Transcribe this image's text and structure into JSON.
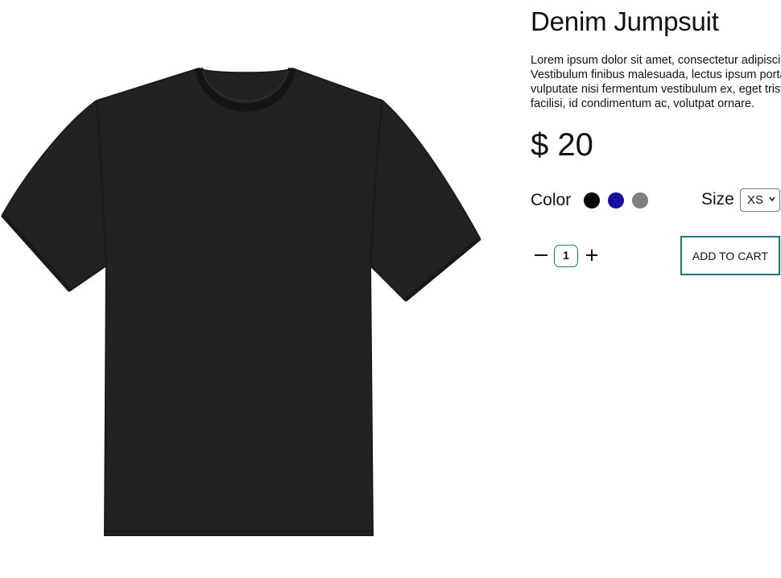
{
  "product": {
    "title": "Denim Jumpsuit",
    "description": "Lorem ipsum dolor sit amet, consectetur adipiscing elit. Vestibulum finibus malesuada, lectus ipsum porta nunc, ac vulputate nisi fermentum vestibulum ex, eget tristique tortor. Nulla facilisi, id condimentum ac, volutpat ornare.",
    "price": "$ 20",
    "image_icon": "black-tshirt"
  },
  "options": {
    "color_label": "Color",
    "colors": [
      {
        "name": "black",
        "hex": "#050505"
      },
      {
        "name": "blue",
        "hex": "#1a0f9c"
      },
      {
        "name": "gray",
        "hex": "#808080"
      }
    ],
    "size_label": "Size",
    "size_selected": "XS"
  },
  "quantity": {
    "value": "1",
    "minus_icon": "minus-icon",
    "plus_icon": "plus-icon"
  },
  "cart": {
    "add_label": "ADD TO CART"
  },
  "colors": {
    "accent": "#1a7a80",
    "shirt": "#222222"
  }
}
